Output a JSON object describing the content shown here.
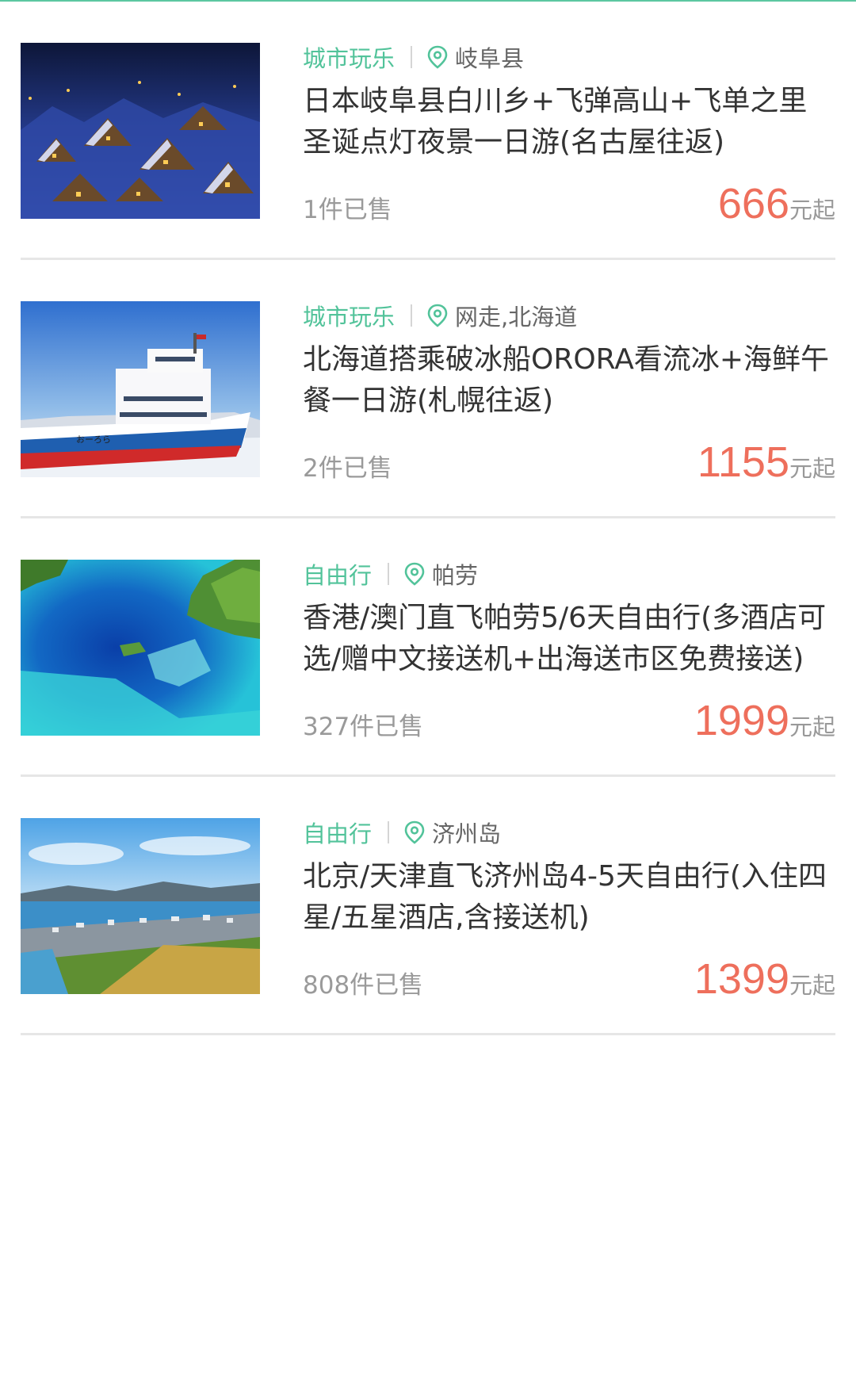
{
  "colors": {
    "accent": "#5cc7a1",
    "category": "#52c39a",
    "price": "#ee6f5c",
    "muted": "#9a9a9a",
    "divider": "#e6e6e6"
  },
  "items": [
    {
      "category": "城市玩乐",
      "location": "岐阜县",
      "title": "日本岐阜县白川乡+飞弹高山+飞单之里圣诞点灯夜景一日游(名古屋往返)",
      "sold": "1件已售",
      "price": "666",
      "price_unit": "元起",
      "image": "snowy-village-night"
    },
    {
      "category": "城市玩乐",
      "location": "网走,北海道",
      "title": "北海道搭乘破冰船ORORA看流冰+海鲜午餐一日游(札幌往返)",
      "sold": "2件已售",
      "price": "1155",
      "price_unit": "元起",
      "image": "icebreaker-ship"
    },
    {
      "category": "自由行",
      "location": "帕劳",
      "title": "香港/澳门直飞帕劳5/6天自由行(多酒店可选/赠中文接送机+出海送市区免费接送)",
      "sold": "327件已售",
      "price": "1999",
      "price_unit": "元起",
      "image": "palau-lagoon"
    },
    {
      "category": "自由行",
      "location": "济州岛",
      "title": "北京/天津直飞济州岛4-5天自由行(入住四星/五星酒店,含接送机)",
      "sold": "808件已售",
      "price": "1399",
      "price_unit": "元起",
      "image": "jeju-coast"
    }
  ]
}
